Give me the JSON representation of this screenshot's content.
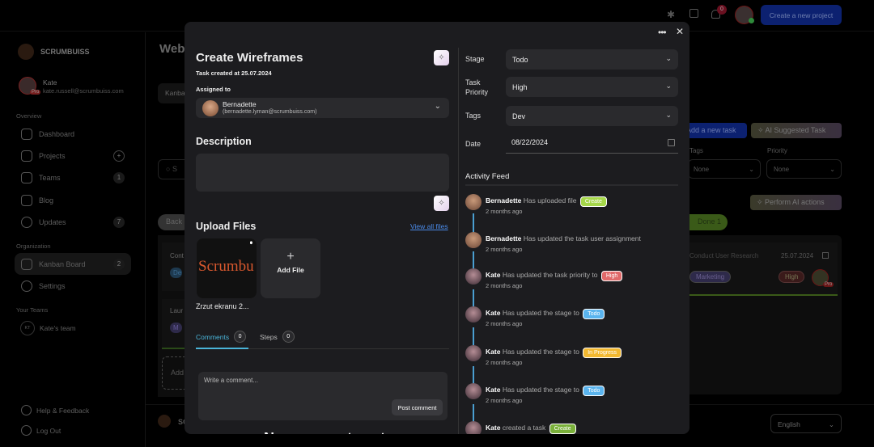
{
  "sidebar": {
    "brand": "SCRUMBUISS",
    "user": {
      "name": "Kate",
      "email": "kate.russell@scrumbuiss.com",
      "badge": "Pro"
    },
    "overview_label": "Overview",
    "items": [
      {
        "label": "Dashboard"
      },
      {
        "label": "Projects",
        "count": "+"
      },
      {
        "label": "Teams",
        "count": "1"
      },
      {
        "label": "Blog"
      },
      {
        "label": "Updates",
        "count": "7"
      }
    ],
    "organization_label": "Organization",
    "org_items": [
      {
        "label": "Kanban Board",
        "count": "2"
      },
      {
        "label": "Settings"
      }
    ],
    "teams_label": "Your Teams",
    "team": {
      "initials": "KT",
      "label": "Kate's team"
    },
    "help": "Help & Feedback",
    "logout": "Log Out"
  },
  "topbar": {
    "notifications": "0",
    "create_project": "Create a new project"
  },
  "background": {
    "title": "Web",
    "view": "Kanban",
    "search": "S",
    "add_task": "Add a new task",
    "ai_suggested": "AI Suggested Task",
    "tags_label": "Tags",
    "tags_value": "None",
    "priority_label": "Priority",
    "priority_value": "None",
    "perform_ai": "Perform AI actions",
    "col_back": "Back",
    "col_done": "Done",
    "done_count": "1",
    "card": {
      "title": "Conduct User Research",
      "date": "25.07.2024",
      "tag": "Marketing",
      "priority": "High",
      "badge": "Pro"
    },
    "left_card1": "Cont",
    "left_tag1": "De",
    "left_card2": "Laur",
    "left_tag2": "M",
    "add": "Add",
    "footer_brand": "SC",
    "language": "English"
  },
  "modal": {
    "title": "Create Wireframes",
    "created": "Task created at 25.07.2024",
    "assigned_label": "Assigned to",
    "assignee": {
      "name": "Bernadette",
      "email": "(bernadette.lyman@scrumbuiss.com)"
    },
    "description_label": "Description",
    "upload_label": "Upload Files",
    "view_all": "View all files",
    "file": {
      "preview": "Scrumbu",
      "name": "Zrzut ekranu 2..."
    },
    "add_file": "Add File",
    "tabs": [
      {
        "label": "Comments",
        "count": "0"
      },
      {
        "label": "Steps",
        "count": "0"
      }
    ],
    "comment_placeholder": "Write a comment...",
    "post_comment": "Post comment",
    "cut_text": "No comments yet",
    "stage_label": "Stage",
    "stage": "Todo",
    "priority_label": "Task Priority",
    "priority": "High",
    "tags_label": "Tags",
    "tags": "Dev",
    "date_label": "Date",
    "date": "08/22/2024",
    "activity_label": "Activity Feed",
    "activity": [
      {
        "user": "Bernadette",
        "text": "Has uploaded file",
        "badge": "Create",
        "badge_color": "#a6d84a",
        "time": "2 months ago"
      },
      {
        "user": "Bernadette",
        "text": "Has updated the task user assignment",
        "badge": "",
        "time": "2 months ago"
      },
      {
        "user": "Kate",
        "text": "Has updated the task priority to",
        "badge": "High",
        "badge_color": "#e06a6a",
        "time": "2 months ago"
      },
      {
        "user": "Kate",
        "text": "Has updated the stage to",
        "badge": "Todo",
        "badge_color": "#5ab4ee",
        "time": "2 months ago"
      },
      {
        "user": "Kate",
        "text": "Has updated the stage to",
        "badge": "In Progress",
        "badge_color": "#f2b830",
        "time": "2 months ago"
      },
      {
        "user": "Kate",
        "text": "Has updated the stage to",
        "badge": "Todo",
        "badge_color": "#5ab4ee",
        "time": "2 months ago"
      },
      {
        "user": "Kate",
        "text": "created a task",
        "badge": "Create",
        "badge_color": "#7ab03a",
        "time": ""
      }
    ]
  }
}
